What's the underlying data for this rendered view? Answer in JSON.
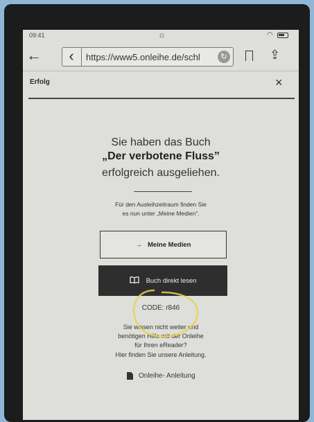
{
  "status": {
    "time": "09:41"
  },
  "browser": {
    "url": "https://www5.onleihe.de/schl"
  },
  "header": {
    "title": "Erfolg",
    "close": "×"
  },
  "message": {
    "line1": "Sie haben das Buch",
    "book_title": "„Der verbotene Fluss”",
    "line3": "erfolgreich ausgeliehen."
  },
  "period": {
    "line1": "Für den Ausleihzeitraum finden Sie",
    "line2": "es nun unter „Meine Medien”."
  },
  "buttons": {
    "my_media": "Meine Medien",
    "read_now": "Buch direkt lesen"
  },
  "code": "CODE: r846",
  "help": {
    "line1": "Sie wissen nicht weiter und",
    "line2": "benötigen Hilfe mit der Onleihe",
    "line3": "für Ihren eReader?",
    "line4": "Hier finden Sie unsere Anleitung."
  },
  "manual_link": "Onleihe- Anleitung"
}
